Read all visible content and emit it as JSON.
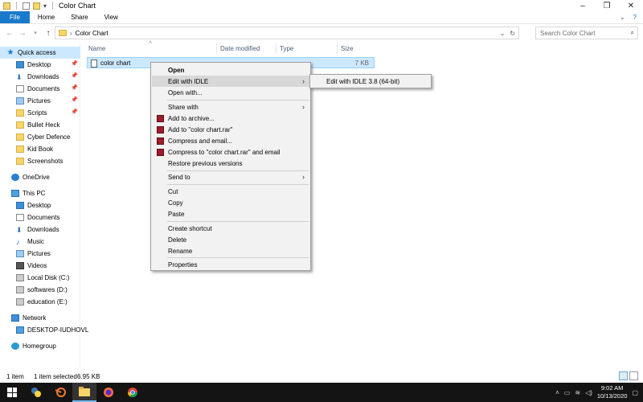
{
  "window": {
    "title": "Color Chart",
    "controls": [
      "–",
      "❐",
      "✕"
    ]
  },
  "ribbon": {
    "tabs": [
      "File",
      "Home",
      "Share",
      "View"
    ]
  },
  "address": {
    "path": "Color Chart",
    "search_placeholder": "Search Color Chart"
  },
  "sidebar": {
    "quick_access": "Quick access",
    "pinned": [
      "Desktop",
      "Downloads",
      "Documents",
      "Pictures",
      "Scripts"
    ],
    "recent": [
      "Bullet Heck",
      "Cyber Defence",
      "Kid Book",
      "Screenshots"
    ],
    "onedrive": "OneDrive",
    "this_pc": "This PC",
    "pc_items": [
      "Desktop",
      "Documents",
      "Downloads",
      "Music",
      "Pictures",
      "Videos",
      "Local Disk (C:)",
      "softwares (D:)",
      "education (E:)"
    ],
    "network": "Network",
    "network_items": [
      "DESKTOP-IUDHOVL"
    ],
    "homegroup": "Homegroup"
  },
  "columns": {
    "name": "Name",
    "date_modified": "Date modified",
    "type": "Type",
    "size": "Size"
  },
  "file": {
    "name": "color chart",
    "size": "7 KB"
  },
  "context_menu": {
    "open": "Open",
    "edit_idle": "Edit with IDLE",
    "open_with": "Open with...",
    "share_with": "Share with",
    "add_archive": "Add to archive...",
    "add_rar": "Add to \"color chart.rar\"",
    "compress_email": "Compress and email...",
    "compress_rar_email": "Compress to \"color chart.rar\" and email",
    "restore": "Restore previous versions",
    "send_to": "Send to",
    "cut": "Cut",
    "copy": "Copy",
    "paste": "Paste",
    "create_shortcut": "Create shortcut",
    "delete": "Delete",
    "rename": "Rename",
    "properties": "Properties"
  },
  "submenu": {
    "item": "Edit with IDLE 3.8 (64-bit)"
  },
  "status": {
    "count": "1 item",
    "selected": "1 item selected",
    "size": "6.95 KB"
  },
  "taskbar": {
    "time": "9:02 AM",
    "date": "10/13/2020"
  }
}
